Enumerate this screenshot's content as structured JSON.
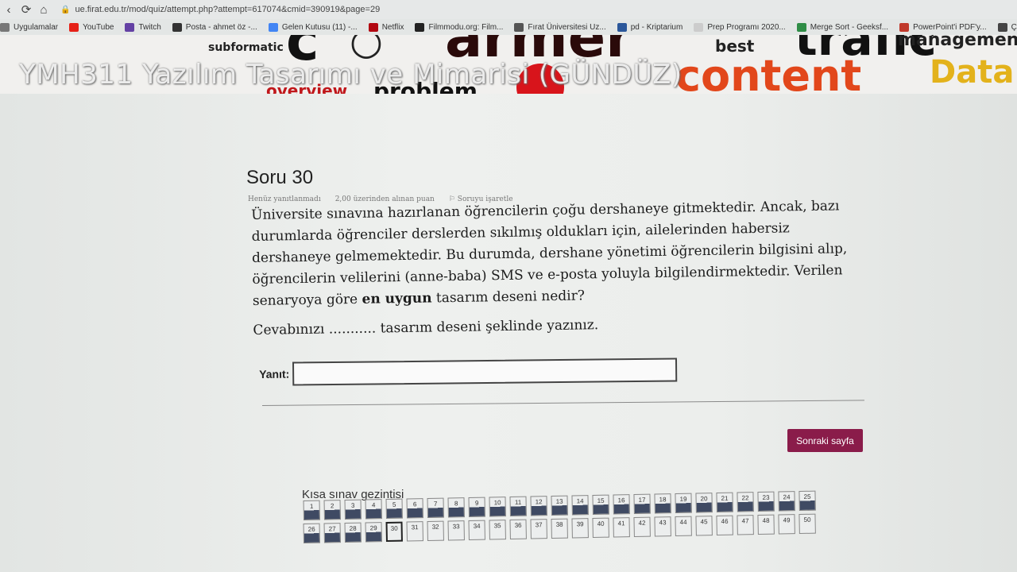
{
  "browser": {
    "url": "ue.firat.edu.tr/mod/quiz/attempt.php?attempt=617074&cmid=390919&page=29",
    "bookmarks": [
      {
        "label": "Uygulamalar",
        "icon": "apps-icon",
        "color": "#777777"
      },
      {
        "label": "YouTube",
        "icon": "youtube-icon",
        "color": "#e62117"
      },
      {
        "label": "Twitch",
        "icon": "twitch-icon",
        "color": "#6441a4"
      },
      {
        "label": "Posta - ahmet öz -...",
        "icon": "mail-icon",
        "color": "#333333"
      },
      {
        "label": "Gelen Kutusu (11) -...",
        "icon": "google-icon",
        "color": "#4285f4"
      },
      {
        "label": "Netflix",
        "icon": "netflix-icon",
        "color": "#b20710"
      },
      {
        "label": "Filmmodu.org: Film...",
        "icon": "film-icon",
        "color": "#222222"
      },
      {
        "label": "Fırat Üniversitesi Uz...",
        "icon": "university-icon",
        "color": "#555555"
      },
      {
        "label": "pd - Kriptarium",
        "icon": "word-icon",
        "color": "#2b579a"
      },
      {
        "label": "Prep Programı 2020...",
        "icon": "blank-icon",
        "color": "#cccccc"
      },
      {
        "label": "Merge Sort - Geeksf...",
        "icon": "gfg-icon",
        "color": "#2f8d46"
      },
      {
        "label": "PowerPoint'i PDF'y...",
        "icon": "pdf-icon",
        "color": "#c0392b"
      },
      {
        "label": "Çevrim Durumu - Bil...",
        "icon": "cc-icon",
        "color": "#444444"
      }
    ]
  },
  "header": {
    "course_title": "YMH311 Yazılım Tasarımı ve Mimarisi (GÜNDÜZ)"
  },
  "question": {
    "title": "Soru 30",
    "status": "Henüz yanıtlanmadı",
    "points": "2,00 üzerinden alınan puan",
    "flag": "Soruyu işaretle",
    "text_part1": "Üniversite sınavına hazırlanan öğrencilerin çoğu dershaneye gitmektedir. Ancak, bazı durumlarda öğrenciler derslerden sıkılmış oldukları için, ailelerinden habersiz dershaneye gelmemektedir. Bu durumda, dershane yönetimi öğrencilerin bilgisini alıp, öğrencilerin velilerini (anne-baba) SMS ve e-posta yoluyla bilgilendirmektedir. Verilen senaryoya göre ",
    "text_bold": "en uygun",
    "text_part2": " tasarım deseni nedir?",
    "hint": "Cevabınızı ........... tasarım deseni şeklinde yazınız.",
    "answer_label": "Yanıt:",
    "answer_value": ""
  },
  "next_button": "Sonraki sayfa",
  "navigation": {
    "title": "Kısa sınav gezintisi",
    "row1": [
      "1",
      "2",
      "3",
      "4",
      "5",
      "6",
      "7",
      "8",
      "9",
      "10",
      "11",
      "12",
      "13",
      "14",
      "15",
      "16",
      "17",
      "18",
      "19",
      "20",
      "21",
      "22",
      "23",
      "24",
      "25"
    ],
    "row2": [
      "26",
      "27",
      "28",
      "29",
      "30",
      "31",
      "32",
      "33",
      "34",
      "35",
      "36",
      "37",
      "38",
      "39",
      "40",
      "41",
      "42",
      "43",
      "44",
      "45",
      "46",
      "47",
      "48",
      "49",
      "50"
    ],
    "answered_count": 29,
    "current": "30"
  },
  "colors": {
    "accent": "#8a1c4a",
    "answered": "#3f4a63"
  }
}
